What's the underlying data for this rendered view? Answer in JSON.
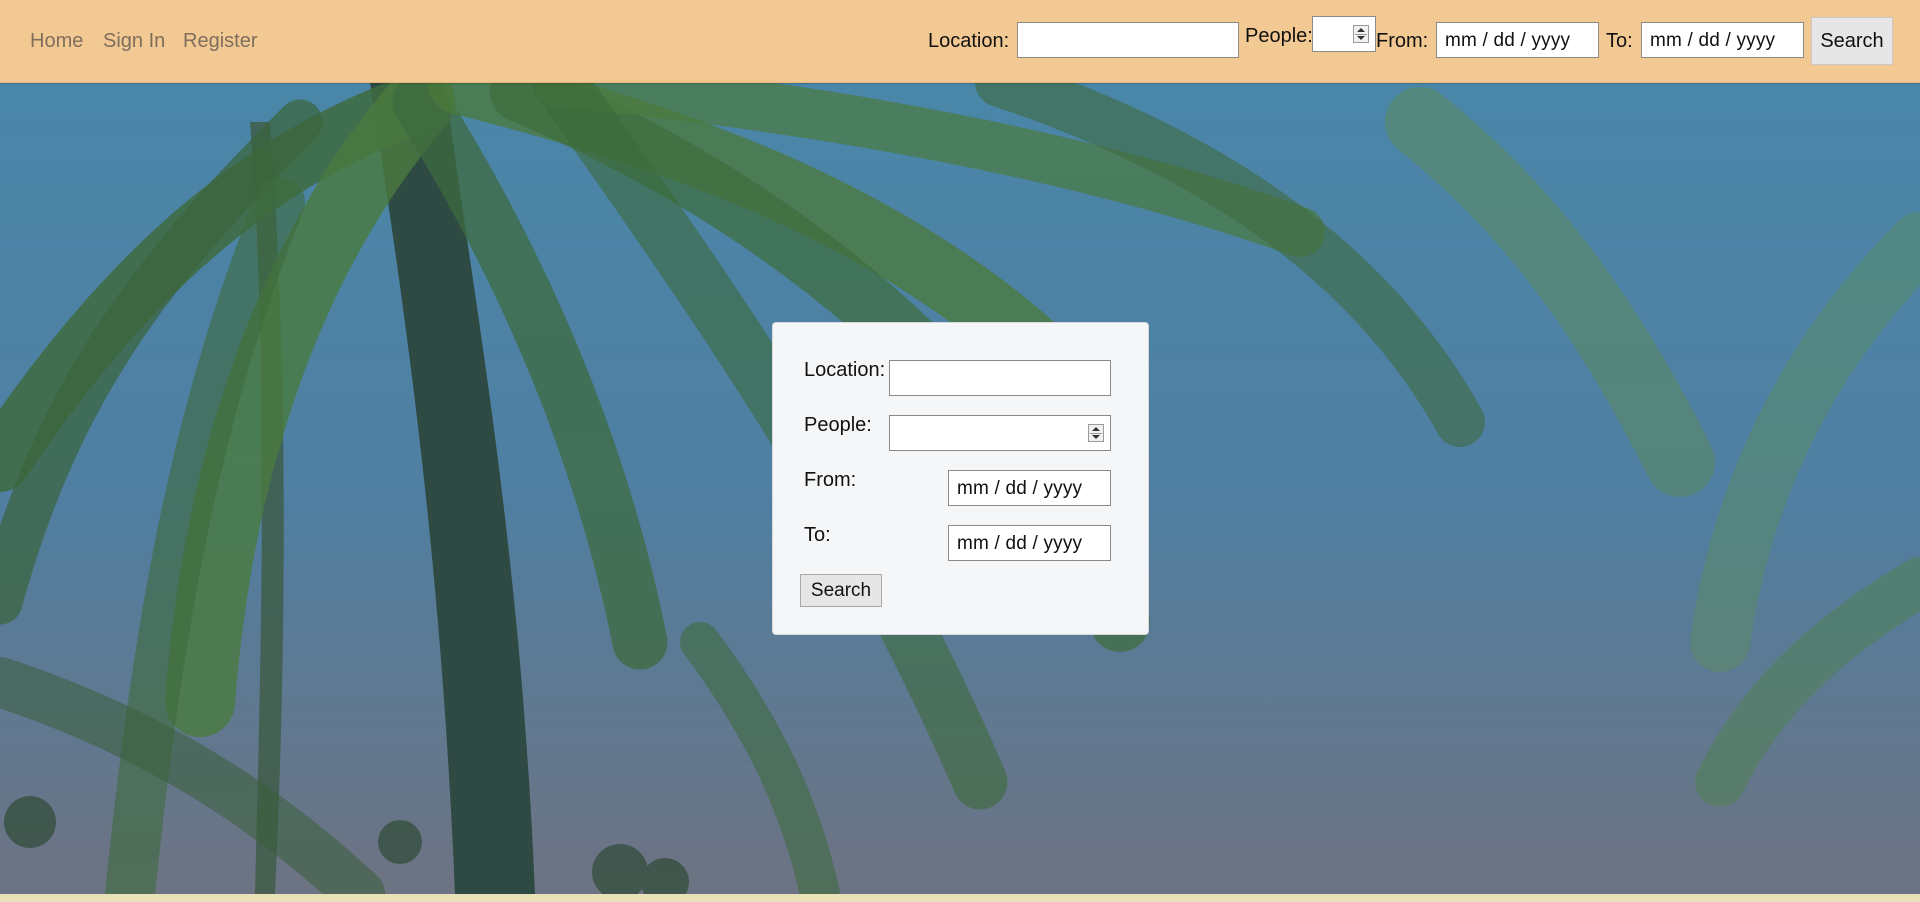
{
  "navbar": {
    "links": {
      "home": "Home",
      "sign_in": "Sign In",
      "register": "Register"
    },
    "search_form": {
      "location_label": "Location:",
      "location_value": "",
      "people_label": "People:",
      "people_value": "",
      "from_label": "From:",
      "from_placeholder": "mm / dd / yyyy",
      "to_label": "To:",
      "to_placeholder": "mm / dd / yyyy",
      "search_button": "Search"
    },
    "background_color": "#f2c992"
  },
  "main_form": {
    "location_label": "Location:",
    "location_value": "",
    "people_label": "People:",
    "people_value": "",
    "from_label": "From:",
    "from_placeholder": "mm / dd / yyyy",
    "to_label": "To:",
    "to_placeholder": "mm / dd / yyyy",
    "search_button": "Search"
  },
  "background": {
    "description_icon": "palm-trees-background",
    "footer_color": "#e9e2b8"
  }
}
